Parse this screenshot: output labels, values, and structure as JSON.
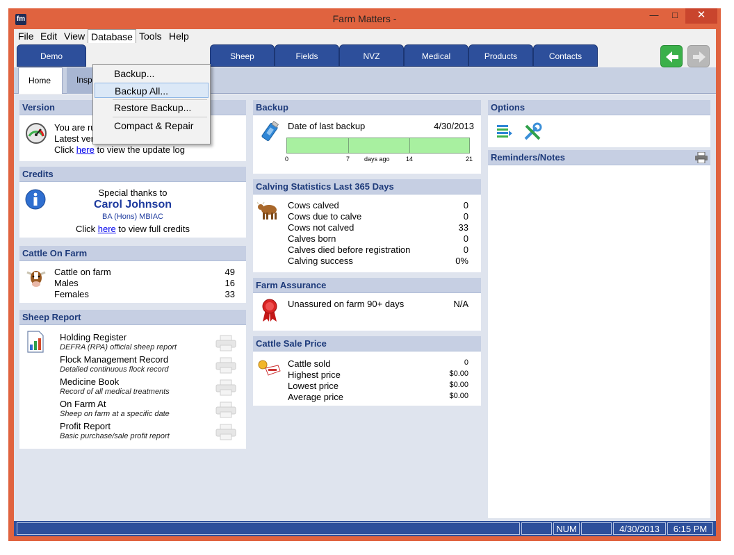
{
  "window": {
    "title": "Farm Matters -",
    "app_icon": "fm"
  },
  "menu": {
    "items": [
      "File",
      "Edit",
      "View",
      "Database",
      "Tools",
      "Help"
    ],
    "database_dropdown": [
      "Backup...",
      "Backup All...",
      "Restore Backup...",
      "Compact & Repair"
    ]
  },
  "tabs": [
    "Demo",
    "Sheep",
    "Fields",
    "NVZ",
    "Medical",
    "Products",
    "Contacts"
  ],
  "subtabs": [
    "Home",
    "Insp"
  ],
  "version": {
    "header": "Version",
    "line1": "You are running version 3.6.0",
    "line2": "Latest version already installed",
    "click_prefix": "Click",
    "link": "here",
    "click_suffix": "to view the update log"
  },
  "credits": {
    "header": "Credits",
    "thanks": "Special thanks to",
    "name": "Carol Johnson",
    "qualification": "BA (Hons) MBIAC",
    "click_prefix": "Click",
    "link": "here",
    "click_suffix": "to view full credits"
  },
  "cattle_on_farm": {
    "header": "Cattle On Farm",
    "rows": [
      {
        "label": "Cattle on farm",
        "value": "49"
      },
      {
        "label": "Males",
        "value": "16"
      },
      {
        "label": "Females",
        "value": "33"
      }
    ]
  },
  "sheep_report": {
    "header": "Sheep Report",
    "items": [
      {
        "title": "Holding Register",
        "desc": "DEFRA (RPA) official sheep report"
      },
      {
        "title": "Flock Management Record",
        "desc": "Detailed continuous flock record"
      },
      {
        "title": "Medicine Book",
        "desc": "Record of all medical treatments"
      },
      {
        "title": "On Farm At",
        "desc": "Sheep on farm at a specific date"
      },
      {
        "title": "Profit Report",
        "desc": "Basic purchase/sale profit report"
      }
    ]
  },
  "backup": {
    "header": "Backup",
    "label": "Date of last backup",
    "date": "4/30/2013",
    "axis_ticks": [
      "0",
      "7",
      "14",
      "21"
    ],
    "axis_label": "days ago",
    "bar_fill_fraction": 1.0,
    "bar_color": "#a8f0a0"
  },
  "calving": {
    "header": "Calving Statistics Last 365 Days",
    "rows": [
      {
        "label": "Cows calved",
        "value": "0"
      },
      {
        "label": "Cows due to calve",
        "value": "0"
      },
      {
        "label": "Cows not calved",
        "value": "33"
      },
      {
        "label": "Calves born",
        "value": "0"
      },
      {
        "label": "Calves died before registration",
        "value": "0"
      },
      {
        "label": "Calving success",
        "value": "0%"
      }
    ]
  },
  "farm_assurance": {
    "header": "Farm Assurance",
    "label": "Unassured on farm 90+ days",
    "value": "N/A"
  },
  "cattle_sale": {
    "header": "Cattle Sale Price",
    "rows": [
      {
        "label": "Cattle sold",
        "value": "0"
      },
      {
        "label": "Highest price",
        "value": "$0.00"
      },
      {
        "label": "Lowest price",
        "value": "$0.00"
      },
      {
        "label": "Average price",
        "value": "$0.00"
      }
    ]
  },
  "options": {
    "header": "Options"
  },
  "reminders": {
    "header": "Reminders/Notes"
  },
  "status": {
    "num": "NUM",
    "date": "4/30/2013",
    "time": "6:15 PM"
  },
  "colors": {
    "accent": "#2d4f9b",
    "frame": "#e0633f",
    "panel_header": "#c6cfe3"
  }
}
